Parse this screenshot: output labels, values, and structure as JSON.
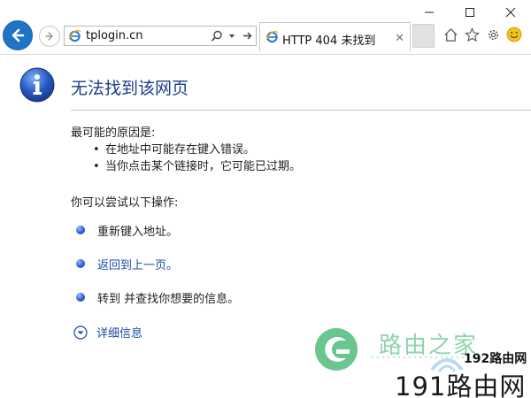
{
  "browser": {
    "address_text": "tplogin.cn",
    "tab_title": "HTTP 404 未找到",
    "tab_close": "✕",
    "icons": [
      "back-arrow-icon",
      "forward-arrow-icon",
      "ie-page-icon",
      "search-icon",
      "dropdown-arrow-icon",
      "go-arrow-icon",
      "home-icon",
      "favorites-star-icon",
      "settings-gear-icon",
      "feedback-smiley-icon",
      "minimize-icon",
      "maximize-icon",
      "close-icon"
    ],
    "accent_color": "#1f74c8"
  },
  "page": {
    "title": "无法找到该网页",
    "reasons_label": "最可能的原因是:",
    "reasons": [
      "在地址中可能存在键入错误。",
      "当你点击某个链接时，它可能已过期。"
    ],
    "bullet_char": "•",
    "try_label": "你可以尝试以下操作:",
    "actions": [
      {
        "text": "重新键入地址。",
        "is_link": false
      },
      {
        "text": "返回到上一页。",
        "is_link": true
      },
      {
        "text": "转到  并查找你想要的信息。",
        "is_link": false
      }
    ],
    "details_label": "详细信息",
    "title_color": "#1a3c87",
    "link_color": "#1a4aa8"
  },
  "watermark": {
    "brand_cn": "路由之家",
    "badge": "192路由网",
    "site": "191路由网"
  }
}
